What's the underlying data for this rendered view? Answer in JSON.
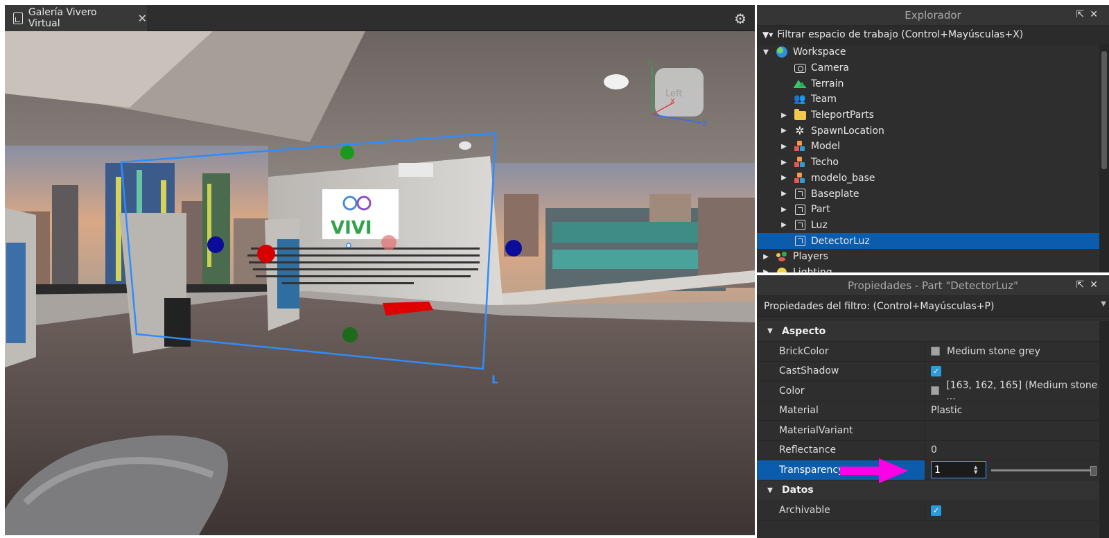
{
  "viewport": {
    "tab_title": "Galería Vivero Virtual",
    "tab_close": "✕",
    "gizmo": {
      "face_label": "Left",
      "axis_x": "X",
      "axis_y": "Y",
      "axis_z": "Z"
    },
    "selection_label": "L",
    "sign_text": "VIVI"
  },
  "explorer": {
    "title": "Explorador",
    "filter_placeholder": "Filtrar espacio de trabajo (Control+Mayúsculas+X)",
    "items": [
      {
        "label": "Workspace",
        "icon": "globe-icon",
        "depth": 0,
        "arrow": "▼"
      },
      {
        "label": "Camera",
        "icon": "camera-icon",
        "depth": 1,
        "arrow": ""
      },
      {
        "label": "Terrain",
        "icon": "terrain-icon",
        "depth": 1,
        "arrow": ""
      },
      {
        "label": "Team",
        "icon": "team-icon",
        "depth": 1,
        "arrow": ""
      },
      {
        "label": "TeleportParts",
        "icon": "folder-icon",
        "depth": 1,
        "arrow": "▶"
      },
      {
        "label": "SpawnLocation",
        "icon": "spawn-icon",
        "depth": 1,
        "arrow": "▶"
      },
      {
        "label": "Model",
        "icon": "model-icon",
        "depth": 1,
        "arrow": "▶"
      },
      {
        "label": "Techo",
        "icon": "model-icon",
        "depth": 1,
        "arrow": "▶"
      },
      {
        "label": "modelo_base",
        "icon": "model-icon",
        "depth": 1,
        "arrow": "▶"
      },
      {
        "label": "Baseplate",
        "icon": "part-icon",
        "depth": 1,
        "arrow": "▶"
      },
      {
        "label": "Part",
        "icon": "part-icon",
        "depth": 1,
        "arrow": "▶"
      },
      {
        "label": "Luz",
        "icon": "part-icon",
        "depth": 1,
        "arrow": "▶"
      },
      {
        "label": "DetectorLuz",
        "icon": "part-icon",
        "depth": 1,
        "arrow": "",
        "selected": true
      },
      {
        "label": "Players",
        "icon": "players-icon",
        "depth": 0,
        "arrow": "▶"
      },
      {
        "label": "Lighting",
        "icon": "lighting-icon",
        "depth": 0,
        "arrow": "▶"
      }
    ]
  },
  "properties": {
    "title": "Propiedades - Part \"DetectorLuz\"",
    "filter_placeholder": "Propiedades del filtro: (Control+Mayúsculas+P)",
    "section_aspecto": "Aspecto",
    "section_datos": "Datos",
    "rows": {
      "brickcolor": {
        "name": "BrickColor",
        "value": "Medium stone grey",
        "swatch": "#a3a2a5"
      },
      "castshadow": {
        "name": "CastShadow",
        "checked": true
      },
      "color": {
        "name": "Color",
        "value": "[163, 162, 165] (Medium stone ...",
        "swatch": "#a3a2a5"
      },
      "material": {
        "name": "Material",
        "value": "Plastic"
      },
      "materialvariant": {
        "name": "MaterialVariant",
        "value": ""
      },
      "reflectance": {
        "name": "Reflectance",
        "value": "0"
      },
      "transparency": {
        "name": "Transparency",
        "value": "1",
        "slider_fraction": 1.0
      },
      "archivable": {
        "name": "Archivable",
        "checked": true
      }
    }
  },
  "colors": {
    "selection_blue": "#0b5cad",
    "checkbox_blue": "#2d9cdb",
    "annotation_magenta": "#ff00e6",
    "selection_box": "#2e8cff"
  }
}
